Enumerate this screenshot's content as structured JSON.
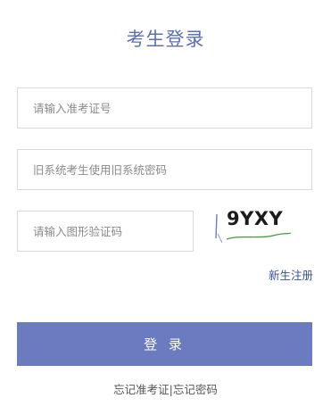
{
  "page": {
    "title": "考生登录"
  },
  "form": {
    "exam_id": {
      "placeholder": "请输入准考证号",
      "value": ""
    },
    "password": {
      "placeholder": "旧系统考生使用旧系统密码",
      "value": ""
    },
    "captcha": {
      "placeholder": "请输入图形验证码",
      "value": ""
    }
  },
  "captcha_image": {
    "text": "9YXY"
  },
  "links": {
    "register": "新生注册",
    "forgot_exam_id": "忘记准考证",
    "separator": "|",
    "forgot_password": "忘记密码"
  },
  "buttons": {
    "login": "登 录"
  },
  "colors": {
    "accent": "#6a7bbf",
    "title": "#5b6fb7",
    "link": "#3b4f96"
  }
}
